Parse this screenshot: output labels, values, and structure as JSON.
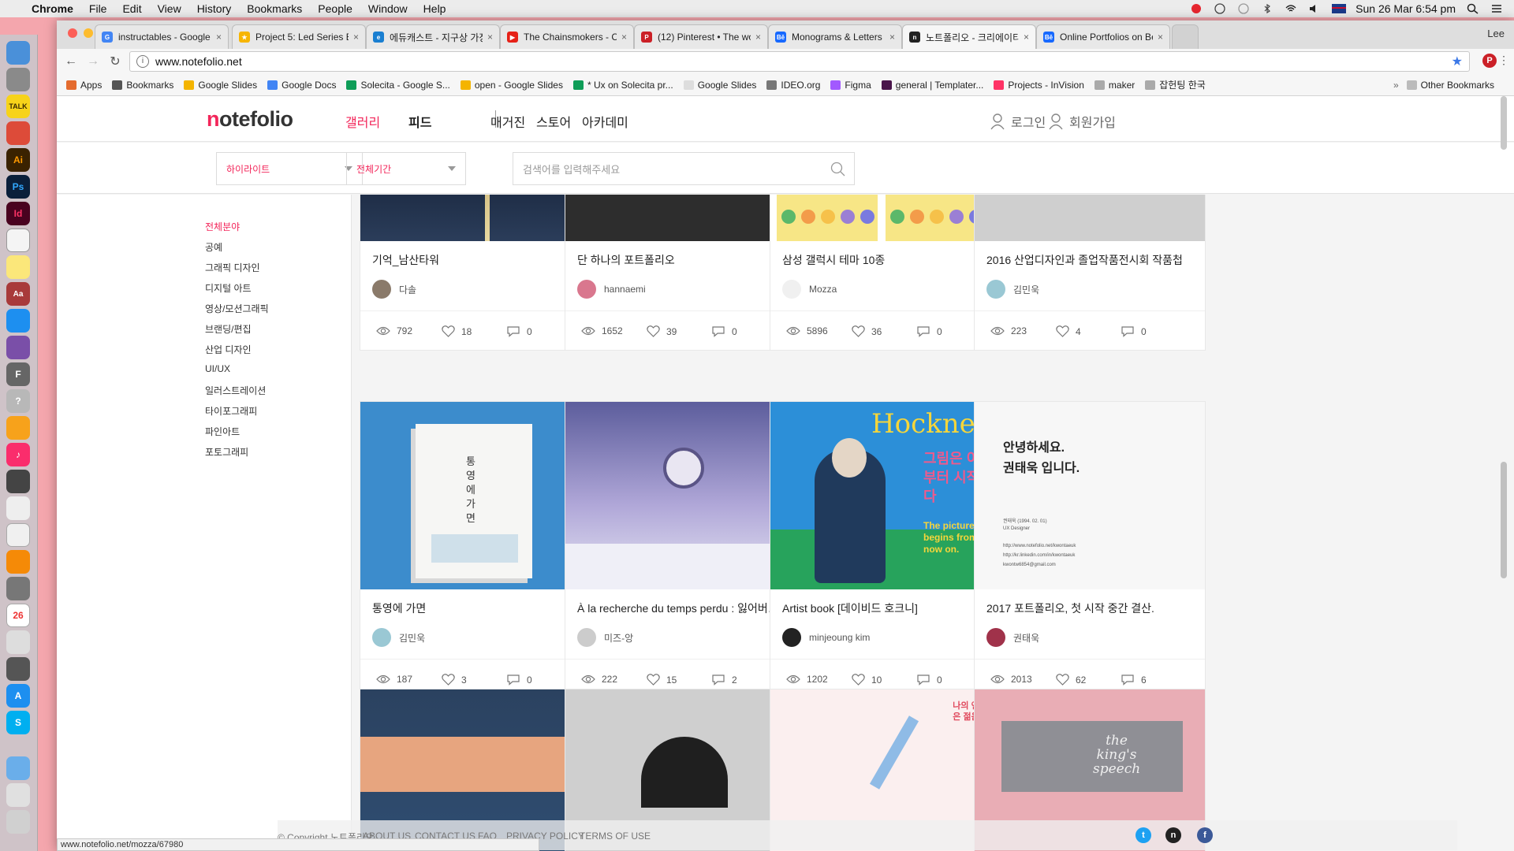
{
  "menubar": {
    "app": "Chrome",
    "items": [
      "File",
      "Edit",
      "View",
      "History",
      "Bookmarks",
      "People",
      "Window",
      "Help"
    ],
    "clock": "Sun 26 Mar  6:54 pm"
  },
  "tabs": [
    {
      "title": "instructables - Google Sea",
      "fav_color": "#4285f4",
      "fav": "G"
    },
    {
      "title": "Project 5: Led Series Blink",
      "fav_color": "#f7b500",
      "fav": "★"
    },
    {
      "title": "에듀캐스트 - 지구상 가장 큰 학",
      "fav_color": "#1a7fd1",
      "fav": "e"
    },
    {
      "title": "The Chainsmokers - Clo",
      "fav_color": "#e62117",
      "fav": "▶"
    },
    {
      "title": "(12) Pinterest • The world'",
      "fav_color": "#cb2027",
      "fav": "P"
    },
    {
      "title": "Monograms & Letters I on",
      "fav_color": "#1769ff",
      "fav": "Bē"
    },
    {
      "title": "노트폴리오 - 크리에이티브 네트",
      "fav_color": "#222222",
      "fav": "n"
    },
    {
      "title": "Online Portfolios on Behan",
      "fav_color": "#1769ff",
      "fav": "Bē"
    }
  ],
  "profile": "Lee",
  "url": "www.notefolio.net",
  "bookmarks": [
    {
      "label": "Apps",
      "color": "#e46b2e"
    },
    {
      "label": "Bookmarks",
      "color": "#555555"
    },
    {
      "label": "Google Slides",
      "color": "#f4b400"
    },
    {
      "label": "Google Docs",
      "color": "#4285f4"
    },
    {
      "label": "Solecita - Google S...",
      "color": "#0f9d58"
    },
    {
      "label": "open - Google Slides",
      "color": "#f4b400"
    },
    {
      "label": "* Ux on Solecita pr...",
      "color": "#0f9d58"
    },
    {
      "label": "Google Slides",
      "color": "#dddddd"
    },
    {
      "label": "IDEO.org",
      "color": "#777777"
    },
    {
      "label": "Figma",
      "color": "#a259ff"
    },
    {
      "label": "general | Templater...",
      "color": "#4a154b"
    },
    {
      "label": "Projects - InVision",
      "color": "#ff3366"
    },
    {
      "label": "maker",
      "color": "#aaaaaa"
    },
    {
      "label": "잡헌팅 한국",
      "color": "#aaaaaa"
    }
  ],
  "bookmarks_other": "Other Bookmarks",
  "site": {
    "logo": "otefolio",
    "logo_n": "n",
    "nav": [
      "갤러리",
      "피드",
      "매거진",
      "스토어",
      "아카데미"
    ],
    "login": "로그인",
    "signup": "회원가입",
    "filter1": "하이라이트",
    "filter2": "전체기간",
    "search_placeholder": "검색어를 입력해주세요"
  },
  "categories": [
    "전체분야",
    "공예",
    "그래픽 디자인",
    "디지털 아트",
    "영상/모션그래픽",
    "브랜딩/편집",
    "산업 디자인",
    "UI/UX",
    "일러스트레이션",
    "타이포그래피",
    "파인아트",
    "포토그래피"
  ],
  "cards": [
    {
      "title": "기억_남산타워",
      "author": "다솔",
      "views": "792",
      "likes": "18",
      "comments": "0",
      "thumb": "#1d2a40",
      "avatar": "#8a7a6a"
    },
    {
      "title": "단 하나의 포트폴리오",
      "author": "hannaemi",
      "views": "1652",
      "likes": "39",
      "comments": "0",
      "thumb": "#2c2c2c",
      "avatar": "#d9778e"
    },
    {
      "title": "삼성 갤럭시 테마 10종",
      "author": "Mozza",
      "views": "5896",
      "likes": "36",
      "comments": "0",
      "thumb": "#f3e27a",
      "avatar": "#f0f0f0"
    },
    {
      "title": "2016 산업디자인과 졸업작품전시회 작품첩",
      "author": "김민욱",
      "views": "223",
      "likes": "4",
      "comments": "0",
      "thumb": "#cfcfcf",
      "avatar": "#9ac8d4"
    },
    {
      "title": "통영에 가면",
      "author": "김민욱",
      "views": "187",
      "likes": "3",
      "comments": "0",
      "thumb": "#3f8fce",
      "avatar": "#9ac8d4"
    },
    {
      "title": "À la recherche du temps perdu : 잃어버린 시간을 찾아서",
      "author": "미즈-앙",
      "views": "222",
      "likes": "15",
      "comments": "2",
      "thumb": "#6f6fae",
      "avatar": "#cccccc"
    },
    {
      "title": "Artist book [데이비드 호크니]",
      "author": "minjeoung kim",
      "views": "1202",
      "likes": "10",
      "comments": "0",
      "thumb": "#2a8fd8",
      "avatar": "#222222"
    },
    {
      "title": "2017 포트폴리오, 첫 시작 중간 결산.",
      "author": "권태욱",
      "views": "2013",
      "likes": "62",
      "comments": "6",
      "thumb": "#f6f6f6",
      "avatar": "#a0324a"
    },
    {
      "title": "",
      "author": "",
      "views": "",
      "likes": "",
      "comments": "",
      "thumb": "#2f4a66",
      "avatar": "#ffffff"
    },
    {
      "title": "",
      "author": "",
      "views": "",
      "likes": "",
      "comments": "",
      "thumb": "#cdcdcd",
      "avatar": "#ffffff"
    },
    {
      "title": "",
      "author": "",
      "views": "",
      "likes": "",
      "comments": "",
      "thumb": "#fbeeee",
      "avatar": "#ffffff"
    },
    {
      "title": "",
      "author": "",
      "views": "",
      "likes": "",
      "comments": "",
      "thumb": "#e8aeb6",
      "avatar": "#ffffff"
    }
  ],
  "thumb_text": {
    "card5_book": "통영에 가면",
    "card7_hockney": "Hockney",
    "card7_kr": "그림은 이제부터 시작이다",
    "card7_en": "The picture begins from now on.",
    "card8_greeting": "안녕하세요.",
    "card8_name": "권태욱 입니다.",
    "card8_meta": "권태욱 (1994. 02. 01)",
    "card8_role": "UX Designer",
    "card8_link1": "http://www.notefolio.net/kwontaeuk",
    "card8_link2": "http://kr.linkedin.com/in/kwontaeuk",
    "card8_link3": "kwontw6854@gmail.com",
    "card11_kr": "나의 연필 잡은 젊음은 몇점??",
    "card11_mark": "점",
    "card12_title": "the king's speech"
  },
  "footer": {
    "copyright": "© Copyright 노트폴리오",
    "links": [
      "ABOUT US",
      "CONTACT US",
      "FAQ",
      "PRIVACY POLICY",
      "TERMS OF USE"
    ]
  },
  "status_url": "www.notefolio.net/mozza/67980",
  "colors": {
    "accent": "#f3265a"
  }
}
